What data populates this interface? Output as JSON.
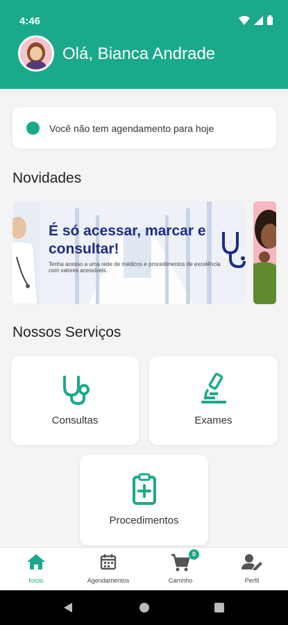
{
  "status_bar": {
    "time": "4:46"
  },
  "header": {
    "greeting": "Olá, Bianca Andrade"
  },
  "notice": {
    "text": "Você não tem agendamento para hoje"
  },
  "sections": {
    "news_title": "Novidades",
    "services_title": "Nossos Serviços"
  },
  "banner": {
    "headline": "É só acessar, marcar e consultar!",
    "subtext": "Tenha acesso a uma rede de médicos e procedimentos de excelência com valores acessíveis."
  },
  "services": [
    {
      "label": "Consultas",
      "icon": "stethoscope-icon"
    },
    {
      "label": "Exames",
      "icon": "microscope-icon"
    },
    {
      "label": "Procedimentos",
      "icon": "clipboard-plus-icon"
    }
  ],
  "bottom_nav": {
    "items": [
      {
        "label": "Início",
        "icon": "home-icon",
        "active": true
      },
      {
        "label": "Agendamentos",
        "icon": "calendar-icon"
      },
      {
        "label": "Carrinho",
        "icon": "cart-icon",
        "badge": "0"
      },
      {
        "label": "Perfil",
        "icon": "user-edit-icon"
      }
    ]
  },
  "colors": {
    "accent": "#1aa98a",
    "banner_text": "#1e2c82"
  }
}
